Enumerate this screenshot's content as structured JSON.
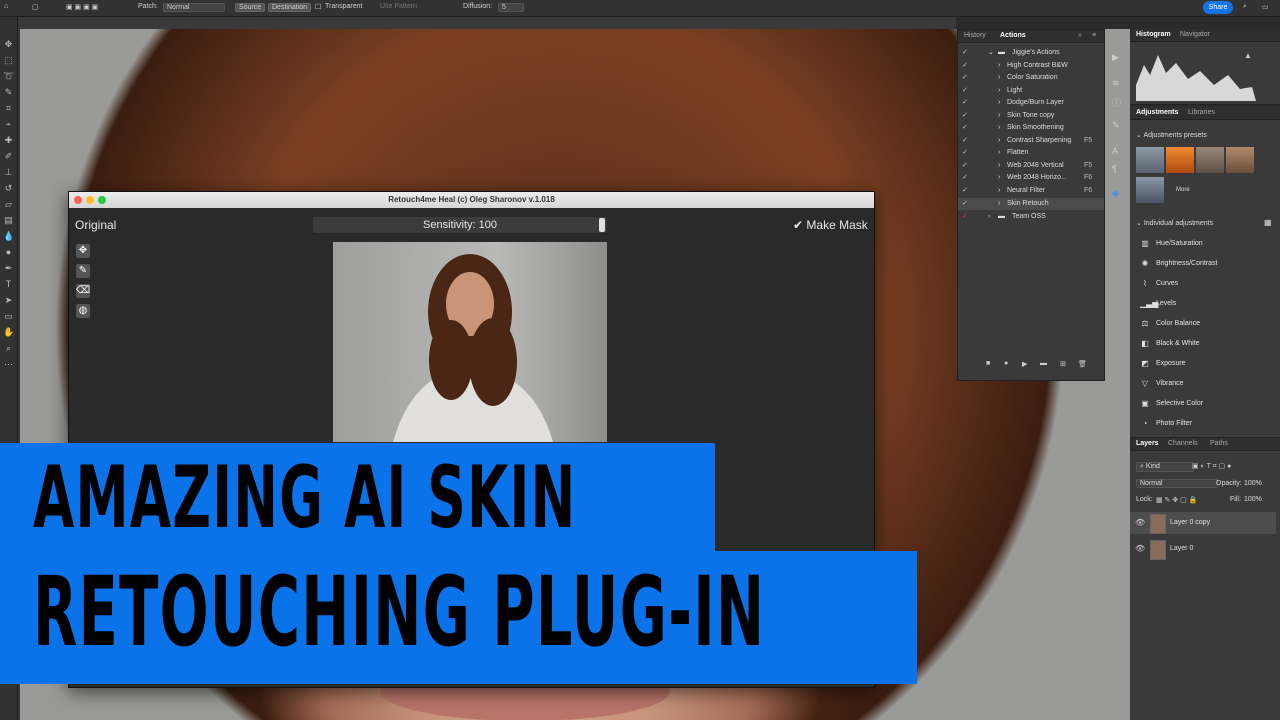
{
  "optionsbar": {
    "patch_label": "Patch:",
    "patch_value": "Normal",
    "source": "Source",
    "destination": "Destination",
    "transparent": "Transparent",
    "use_pattern": "Use Pattern",
    "diffusion_label": "Diffusion:",
    "diffusion_value": "5",
    "share": "Share"
  },
  "plugin": {
    "title": "Retouch4me Heal (c) Oleg Sharonov v.1.018",
    "original": "Original",
    "sensitivity": "Sensitivity: 100",
    "sensitivity_value": 100,
    "make_mask": "Make Mask"
  },
  "actions_panel": {
    "tabs": [
      "History",
      "Actions"
    ],
    "active_tab": "Actions",
    "set_name": "Jiggie's Actions",
    "items": [
      {
        "label": "High Contrast B&W",
        "key": ""
      },
      {
        "label": "Color Saturation",
        "key": ""
      },
      {
        "label": "Light",
        "key": ""
      },
      {
        "label": "Dodge/Burn Layer",
        "key": ""
      },
      {
        "label": "Skin Tone copy",
        "key": ""
      },
      {
        "label": "Skin Smoothening",
        "key": ""
      },
      {
        "label": "Contrast Sharpening",
        "key": "F5"
      },
      {
        "label": "Flatten",
        "key": ""
      },
      {
        "label": "Web 2048 Vertical",
        "key": "F5"
      },
      {
        "label": "Web 2048 Horizo...",
        "key": "F6"
      },
      {
        "label": "Neural Filter",
        "key": "F6"
      },
      {
        "label": "Skin Retouch",
        "key": ""
      }
    ],
    "second_set": "Team OSS"
  },
  "histogram_panel": {
    "tabs": [
      "Histogram",
      "Navigator"
    ],
    "active_tab": "Histogram"
  },
  "adjustments_panel": {
    "tabs": [
      "Adjustments",
      "Libraries"
    ],
    "active_tab": "Adjustments",
    "presets_header": "Adjustments presets",
    "more": "More",
    "individual_header": "Individual adjustments",
    "items": [
      {
        "label": "Hue/Saturation",
        "icon": "hue-saturation-icon"
      },
      {
        "label": "Brightness/Contrast",
        "icon": "brightness-icon"
      },
      {
        "label": "Curves",
        "icon": "curves-icon"
      },
      {
        "label": "Levels",
        "icon": "levels-icon"
      },
      {
        "label": "Color Balance",
        "icon": "color-balance-icon"
      },
      {
        "label": "Black & White",
        "icon": "black-white-icon"
      },
      {
        "label": "Exposure",
        "icon": "exposure-icon"
      },
      {
        "label": "Vibrance",
        "icon": "vibrance-icon"
      },
      {
        "label": "Selective Color",
        "icon": "selective-color-icon"
      },
      {
        "label": "Photo Filter",
        "icon": "photo-filter-icon"
      }
    ]
  },
  "layers_panel": {
    "tabs": [
      "Layers",
      "Channels",
      "Paths"
    ],
    "active_tab": "Layers",
    "kind": "Kind",
    "blend_mode": "Normal",
    "opacity_label": "Opacity:",
    "opacity_value": "100%",
    "lock_label": "Lock:",
    "fill_label": "Fill:",
    "fill_value": "100%",
    "layers": [
      {
        "name": "Layer 0 copy"
      },
      {
        "name": "Layer 0"
      }
    ]
  },
  "banner": {
    "line1": "AMAZING AI SKIN",
    "line2": "RETOUCHING PLUG-IN",
    "color": "#0a73ea"
  }
}
